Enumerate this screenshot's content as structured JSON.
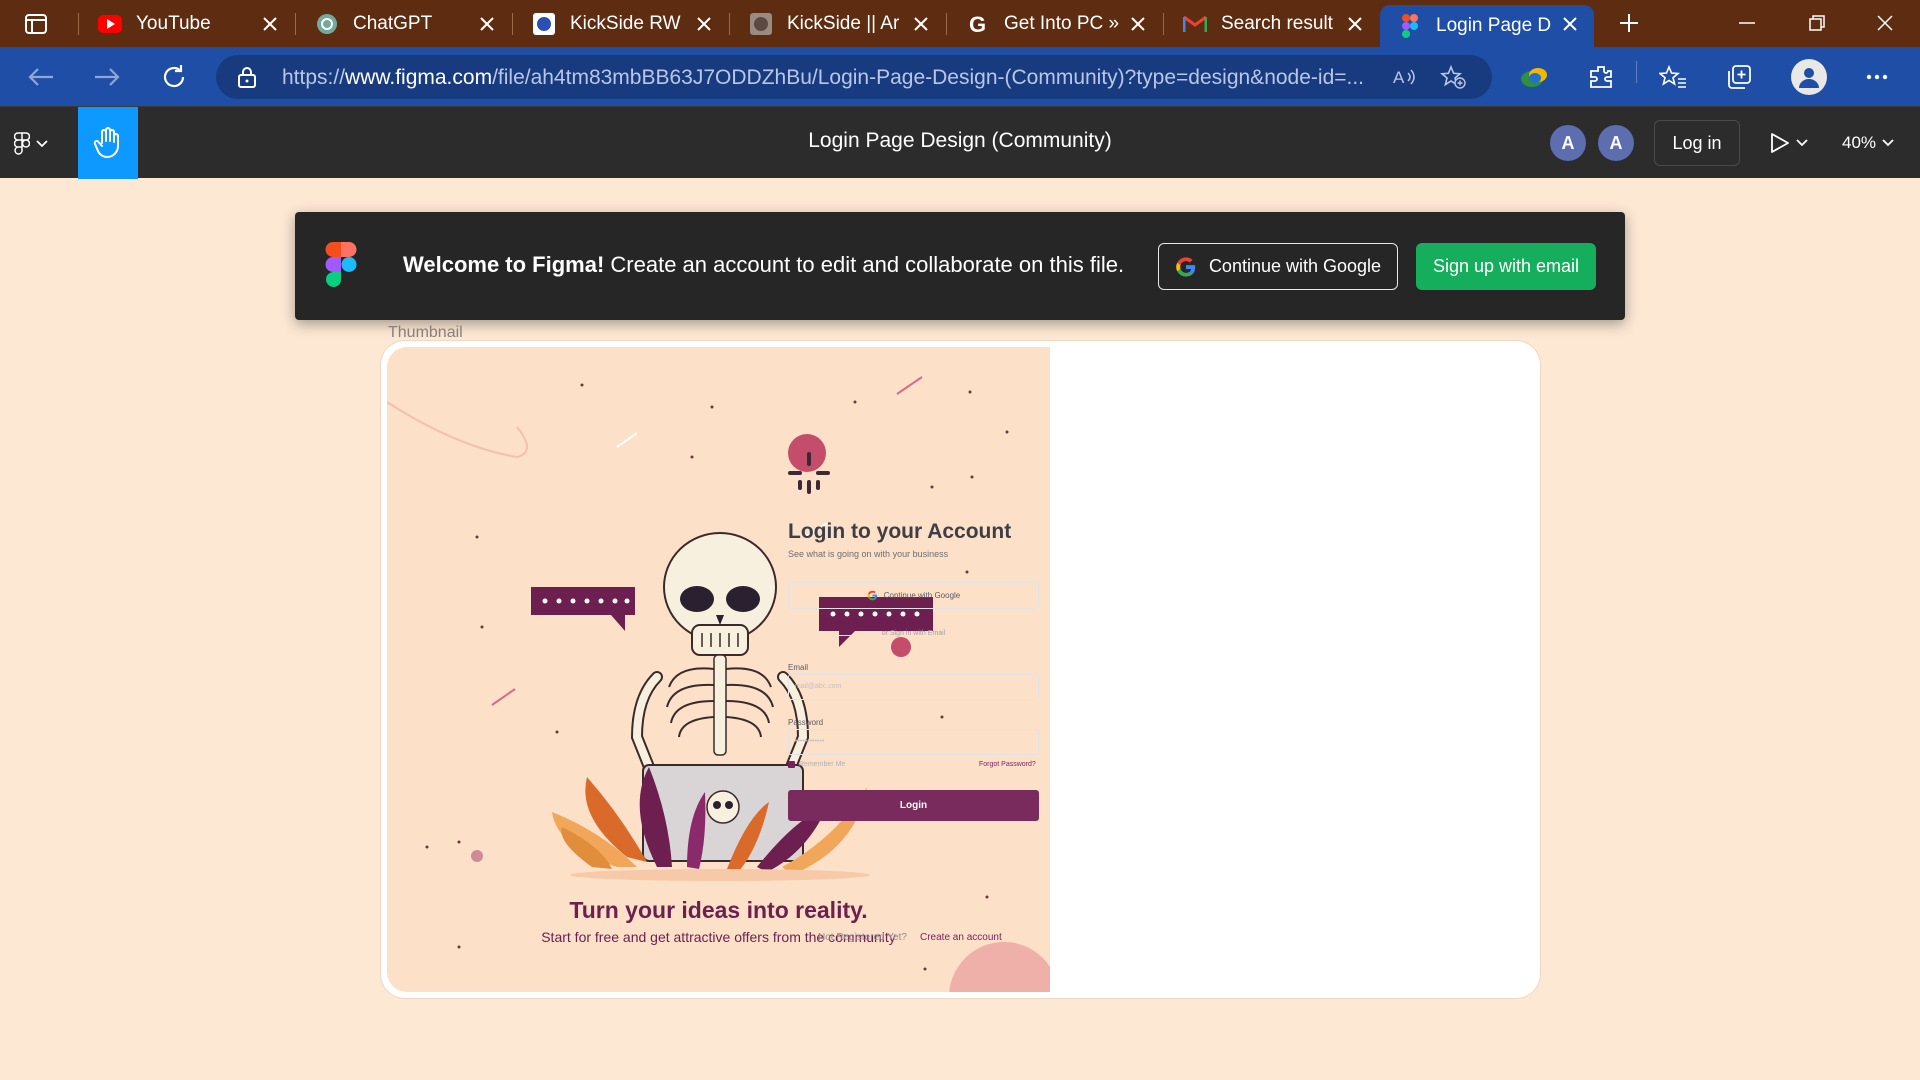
{
  "browser": {
    "tabs": [
      {
        "title": "YouTube",
        "icon": "youtube-icon"
      },
      {
        "title": "ChatGPT",
        "icon": "chatgpt-icon"
      },
      {
        "title": "KickSide RW",
        "icon": "kickside-icon"
      },
      {
        "title": "KickSide || Ar",
        "icon": "kickside-alt-icon"
      },
      {
        "title": "Get Into PC »",
        "icon": "getintopc-icon"
      },
      {
        "title": "Search result",
        "icon": "gmail-icon"
      },
      {
        "title": "Login Page D",
        "icon": "figma-icon",
        "active": true
      }
    ],
    "url_host": "www.figma.com",
    "url_scheme": "https://",
    "url_path": "/file/ah4tm83mbBB63J7ODDZhBu/Login-Page-Design-(Community)?type=design&node-id=..."
  },
  "figma_toolbar": {
    "file_title": "Login Page Design (Community)",
    "avatars": [
      "A",
      "A"
    ],
    "login_label": "Log in",
    "zoom": "40%"
  },
  "banner": {
    "bold_text": "Welcome to Figma!",
    "text": " Create an account to edit and collaborate on this file.",
    "google_button": "Continue with Google",
    "email_button": "Sign up with email"
  },
  "frame": {
    "label": "Thumbnail",
    "art": {
      "headline": "Turn your ideas into reality.",
      "subline": "Start for free and get attractive offers from the community"
    },
    "login": {
      "title": "Login to your Account",
      "subtitle": "See what is going on with your business",
      "google_button": "Continue with Google",
      "divider": "or Sign in with Email",
      "email_label": "Email",
      "email_placeholder": "mail@abc.com",
      "password_label": "Password",
      "password_placeholder": "••••••••••••",
      "remember": "Remember Me",
      "forgot": "Forgot Password?",
      "submit": "Login",
      "not_registered": "Not Registered Yet?",
      "create_account": "Create an account"
    }
  },
  "colors": {
    "tab_strip": "#5e2c10",
    "browser_accent": "#1e4ea6",
    "figma_toolbar": "#2c2c2c",
    "figma_blue": "#0d99ff",
    "signup_green": "#14ae5c",
    "canvas": "#fde8d4",
    "brand_purple": "#7a2b5e"
  }
}
